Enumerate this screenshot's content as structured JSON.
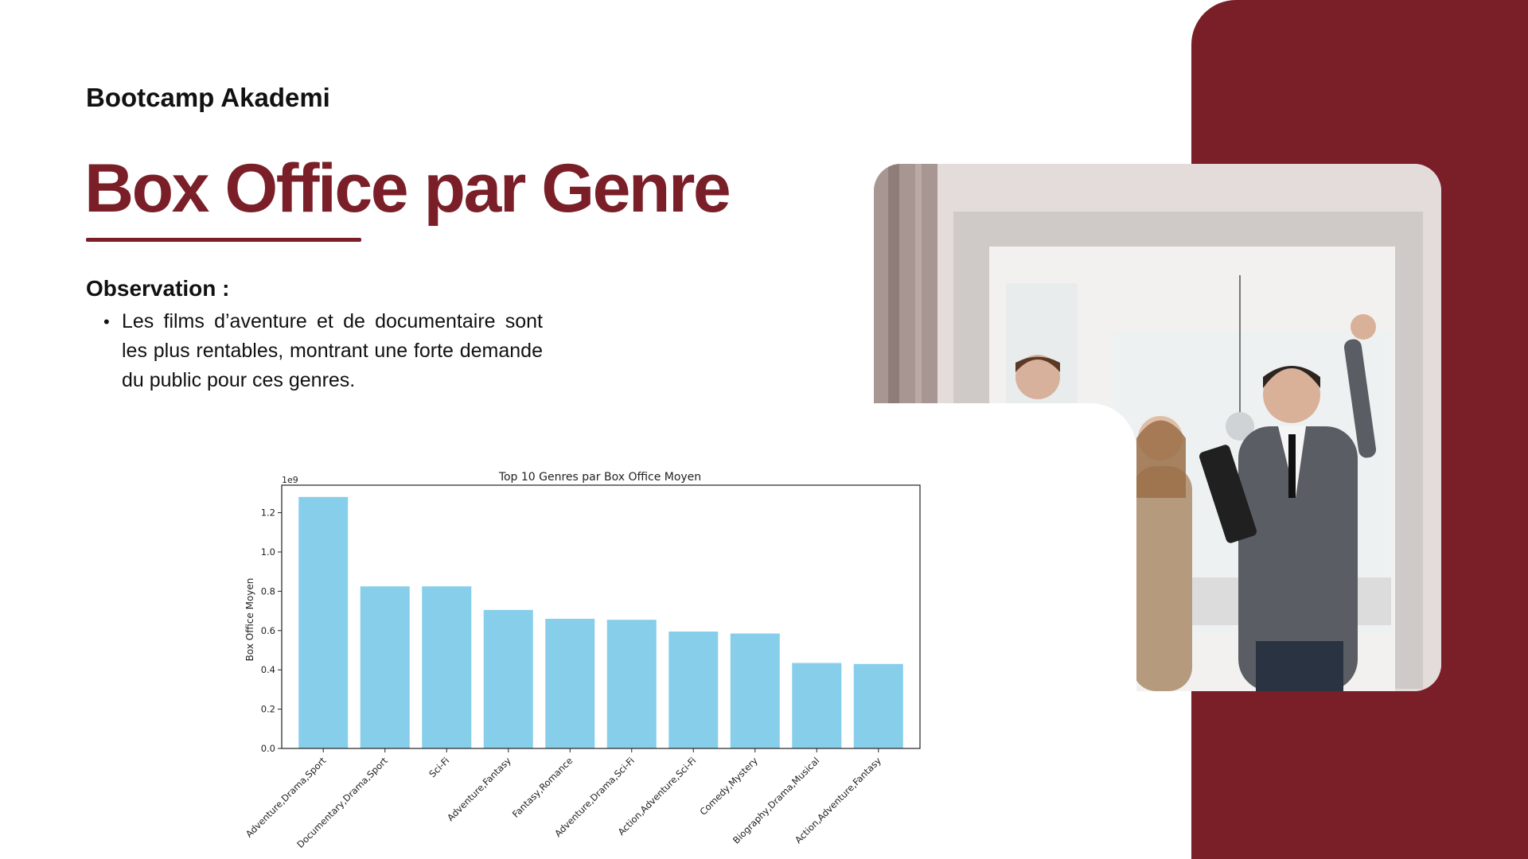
{
  "header": {
    "brand": "Bootcamp Akademi"
  },
  "slide": {
    "title": "Box Office par Genre"
  },
  "observation": {
    "heading": "Observation :",
    "items": [
      "Les films d’aventure et de documentaire sont les plus rentables, montrant une forte demande du public pour ces genres."
    ]
  },
  "colors": {
    "accent": "#7a1f28",
    "bar": "#87ceeb"
  },
  "chart_data": {
    "type": "bar",
    "title": "Top 10 Genres par Box Office Moyen",
    "xlabel": "",
    "ylabel": "Box Office Moyen",
    "offset_label": "1e9",
    "categories": [
      "Adventure,Drama,Sport",
      "Documentary,Drama,Sport",
      "Sci-Fi",
      "Adventure,Fantasy",
      "Fantasy,Romance",
      "Adventure,Drama,Sci-Fi",
      "Action,Adventure,Sci-Fi",
      "Comedy,Mystery",
      "Biography,Drama,Musical",
      "Action,Adventure,Fantasy"
    ],
    "values": [
      1.28,
      0.825,
      0.825,
      0.705,
      0.66,
      0.655,
      0.595,
      0.585,
      0.435,
      0.43
    ],
    "ylim": [
      0,
      1.34
    ],
    "yticks": [
      0.0,
      0.2,
      0.4,
      0.6,
      0.8,
      1.0,
      1.2
    ],
    "ytick_labels": [
      "0.0",
      "0.2",
      "0.4",
      "0.6",
      "0.8",
      "1.0",
      "1.2"
    ],
    "grid": false,
    "legend": "none"
  }
}
